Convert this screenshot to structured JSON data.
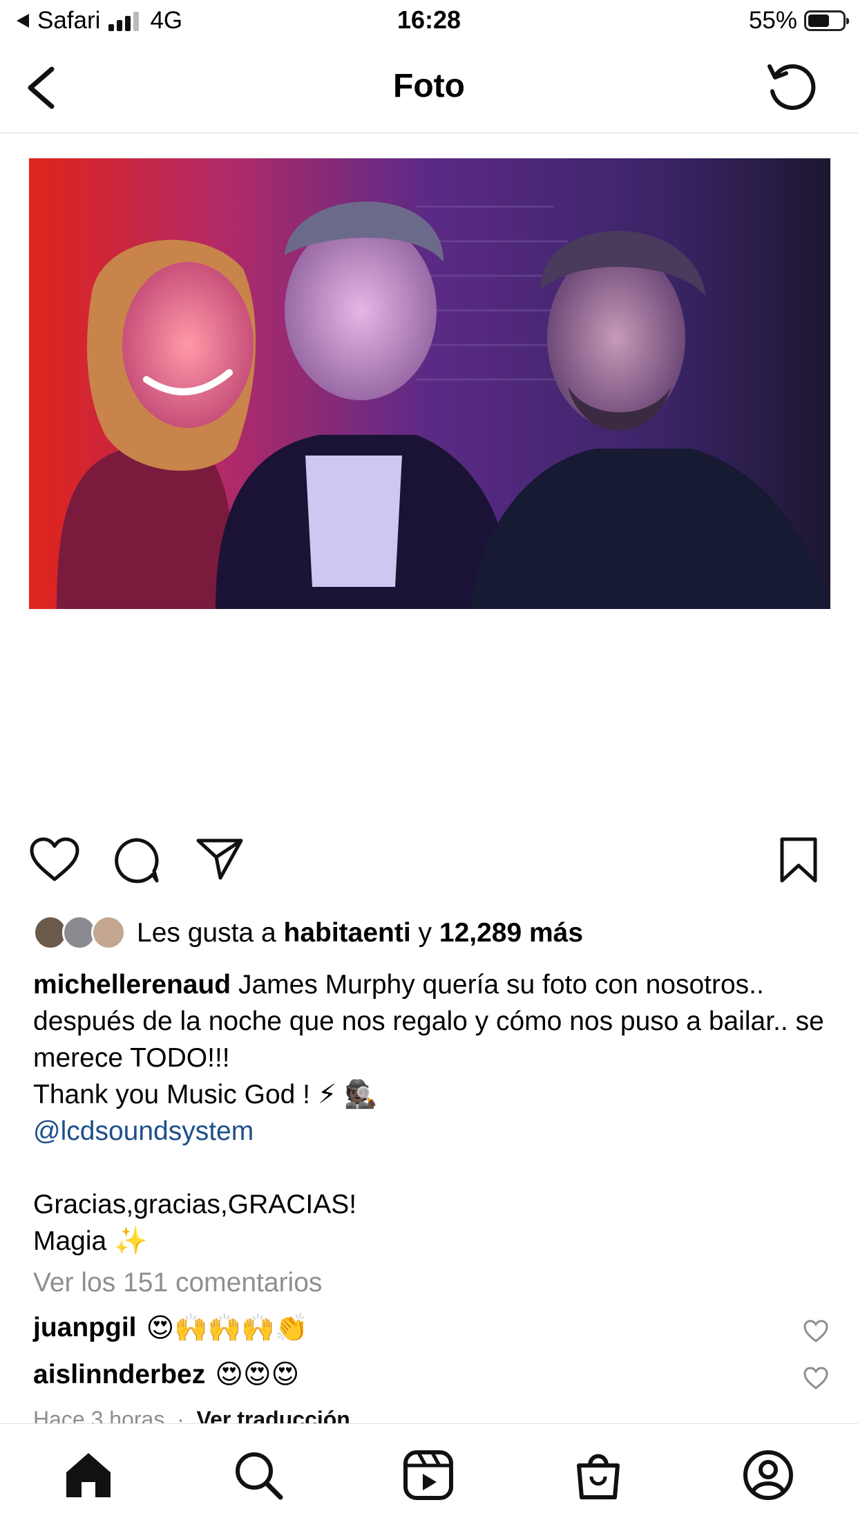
{
  "status_bar": {
    "back_app": "Safari",
    "network": "4G",
    "time": "16:28",
    "battery_percent": "55%",
    "battery_level": 0.55
  },
  "nav": {
    "title": "Foto",
    "back_icon": "chevron-left-icon",
    "refresh_icon": "refresh-icon"
  },
  "post": {
    "likes": {
      "prefix": "Les gusta a",
      "user": "habitaenti",
      "connector": "y",
      "count": "12,289 más"
    },
    "caption": {
      "username": "michellerenaud",
      "line1": "James Murphy quería su foto con nosotros.. después de la noche que nos regalo y cómo nos puso a bailar.. se merece TODO!!!",
      "line2": "Thank you Music God ! ⚡ 🕵🏿",
      "mention": "@lcdsoundsystem",
      "line3": "Gracias,gracias,GRACIAS!",
      "line4": "Magia ✨"
    },
    "view_comments": "Ver los 151 comentarios",
    "comments": [
      {
        "user": "juanpgil",
        "text": "😍🙌🙌🙌👏"
      },
      {
        "user": "aislinnderbez",
        "text": "😍😍😍"
      }
    ],
    "time_ago": "Hace 3 horas",
    "translate": "Ver traducción"
  },
  "tabs": [
    "home-icon",
    "search-icon",
    "reels-icon",
    "shop-icon",
    "profile-icon"
  ],
  "colors": {
    "mention": "#1c4f8a",
    "secondary_text": "#8e8e8e",
    "divider": "#dcdcdc"
  }
}
